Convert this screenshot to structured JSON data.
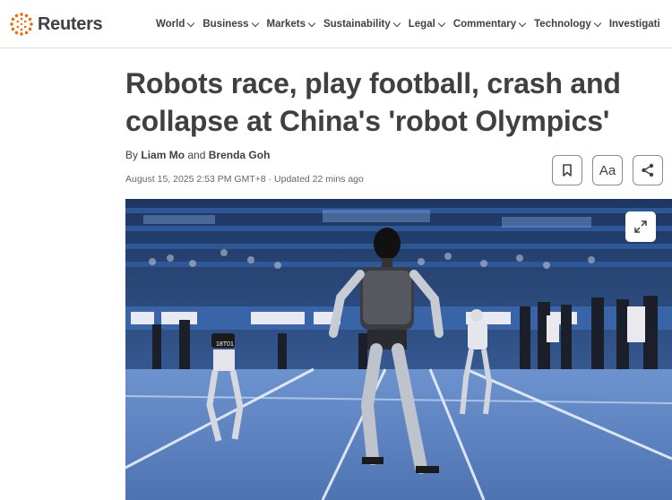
{
  "header": {
    "logo_text": "Reuters",
    "nav": [
      "World",
      "Business",
      "Markets",
      "Sustainability",
      "Legal",
      "Commentary",
      "Technology",
      "Investigati"
    ]
  },
  "article": {
    "headline": "Robots race, play football, crash and collapse at China's 'robot Olympics'",
    "byline_prefix": "By",
    "author1": "Liam Mo",
    "byline_and": "and",
    "author2": "Brenda Goh",
    "dateline": "August 15, 2025 2:53 PM GMT+8 · Updated 22 mins ago",
    "text_size_label": "Aa"
  },
  "photo": {
    "bib_number": "18T01"
  },
  "colors": {
    "logo_orange": "#fa6400",
    "text": "#404040",
    "track": "#5f86c4"
  }
}
